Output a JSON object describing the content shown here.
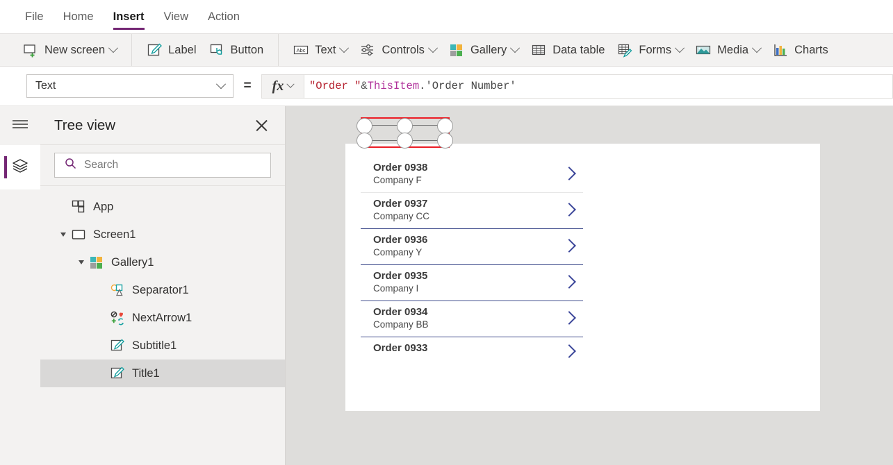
{
  "tabs": [
    {
      "label": "File",
      "active": false
    },
    {
      "label": "Home",
      "active": false
    },
    {
      "label": "Insert",
      "active": true
    },
    {
      "label": "View",
      "active": false
    },
    {
      "label": "Action",
      "active": false
    }
  ],
  "ribbon": {
    "groups": [
      {
        "items": [
          {
            "label": "New screen",
            "icon": "new-screen-icon",
            "chevron": true
          }
        ]
      },
      {
        "items": [
          {
            "label": "Label",
            "icon": "label-icon",
            "chevron": false
          },
          {
            "label": "Button",
            "icon": "button-icon",
            "chevron": false
          }
        ]
      },
      {
        "items": [
          {
            "label": "Text",
            "icon": "text-abc-icon",
            "chevron": true
          },
          {
            "label": "Controls",
            "icon": "controls-sliders-icon",
            "chevron": true
          },
          {
            "label": "Gallery",
            "icon": "gallery-icon",
            "chevron": true
          },
          {
            "label": "Data table",
            "icon": "data-table-icon",
            "chevron": false
          },
          {
            "label": "Forms",
            "icon": "forms-icon",
            "chevron": true
          },
          {
            "label": "Media",
            "icon": "media-image-icon",
            "chevron": true
          },
          {
            "label": "Charts",
            "icon": "charts-bar-icon",
            "chevron": false
          }
        ]
      }
    ]
  },
  "formula_bar": {
    "property": "Text",
    "equals": "=",
    "fx_label": "fx",
    "formula_tokens": [
      {
        "text": "\"Order \"",
        "type": "string"
      },
      {
        "text": " & ",
        "type": "operator"
      },
      {
        "text": "ThisItem",
        "type": "object"
      },
      {
        "text": ".'Order Number'",
        "type": "identifier"
      }
    ]
  },
  "rail": {
    "menu_icon": "hamburger-menu-icon",
    "tree_view_icon": "layers-icon"
  },
  "tree_panel": {
    "title": "Tree view",
    "close_icon": "close-icon",
    "search": {
      "placeholder": "Search",
      "value": "",
      "icon": "search-icon"
    },
    "nodes": [
      {
        "label": "App",
        "icon": "app-icon",
        "indent": 0,
        "expander": "none",
        "selected": false
      },
      {
        "label": "Screen1",
        "icon": "screen-icon",
        "indent": 0,
        "expander": "expanded",
        "selected": false
      },
      {
        "label": "Gallery1",
        "icon": "gallery-icon",
        "indent": 1,
        "expander": "expanded",
        "selected": false
      },
      {
        "label": "Separator1",
        "icon": "shapes-icon",
        "indent": 2,
        "expander": "none",
        "selected": false
      },
      {
        "label": "NextArrow1",
        "icon": "icons-grid-icon",
        "indent": 2,
        "expander": "none",
        "selected": false
      },
      {
        "label": "Subtitle1",
        "icon": "label-icon",
        "indent": 2,
        "expander": "none",
        "selected": false
      },
      {
        "label": "Title1",
        "icon": "label-icon",
        "indent": 2,
        "expander": "none",
        "selected": true
      }
    ]
  },
  "canvas": {
    "gallery_rows": [
      {
        "title": "Order 0938",
        "subtitle": "Company F",
        "arrow": "chevron-right-icon",
        "selected": true,
        "clipped": false
      },
      {
        "title": "Order 0937",
        "subtitle": "Company CC",
        "arrow": "chevron-right-icon",
        "selected": false,
        "clipped": false
      },
      {
        "title": "Order 0936",
        "subtitle": "Company Y",
        "arrow": "chevron-right-icon",
        "selected": false,
        "clipped": false
      },
      {
        "title": "Order 0935",
        "subtitle": "Company I",
        "arrow": "chevron-right-icon",
        "selected": false,
        "clipped": false
      },
      {
        "title": "Order 0934",
        "subtitle": "Company BB",
        "arrow": "chevron-right-icon",
        "selected": false,
        "clipped": false
      },
      {
        "title": "Order 0933",
        "subtitle": "",
        "arrow": "chevron-right-icon",
        "selected": false,
        "clipped": true
      }
    ]
  },
  "colors": {
    "accent_purple": "#742774",
    "selection_red": "#ec1c24",
    "chevron_navy": "#3b4699",
    "panel_gray": "#f3f2f1",
    "canvas_gray": "#dedddb",
    "selected_row": "#d9d8d7"
  }
}
